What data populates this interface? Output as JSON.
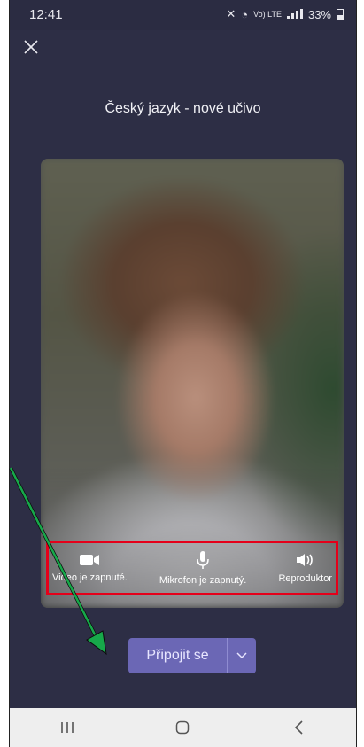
{
  "status_bar": {
    "time": "12:41",
    "network": "Vo) LTE",
    "battery": "33%"
  },
  "meeting": {
    "title": "Český jazyk - nové učivo"
  },
  "controls": {
    "video_label": "Video je zapnuté.",
    "mic_label": "Mikrofon je zapnutý.",
    "speaker_label": "Reproduktor"
  },
  "join": {
    "label": "Připojit se"
  },
  "colors": {
    "background": "#2d2e45",
    "join_button": "#6b67b5",
    "highlight_box": "#e5001a",
    "arrow": "#17a84a"
  },
  "icons": [
    "close-icon",
    "video-camera-icon",
    "microphone-icon",
    "speaker-icon",
    "chevron-down-icon",
    "recent-apps-icon",
    "home-icon",
    "back-icon"
  ]
}
